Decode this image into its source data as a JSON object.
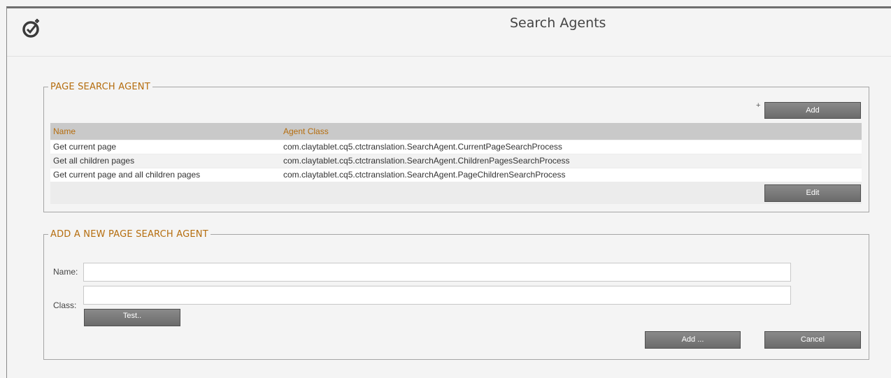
{
  "header": {
    "title": "Search Agents",
    "logo_icon": "target-check-icon"
  },
  "page_search_agent": {
    "legend": "PAGE SEARCH AGENT",
    "add_plus": "+",
    "add_label": "Add",
    "columns": [
      "Name",
      "Agent Class"
    ],
    "rows": [
      {
        "name": "Get current page",
        "agent_class": "com.claytablet.cq5.ctctranslation.SearchAgent.CurrentPageSearchProcess"
      },
      {
        "name": "Get all children pages",
        "agent_class": "com.claytablet.cq5.ctctranslation.SearchAgent.ChildrenPagesSearchProcess"
      },
      {
        "name": "Get current page and all children pages",
        "agent_class": "com.claytablet.cq5.ctctranslation.SearchAgent.PageChildrenSearchProcess"
      }
    ],
    "edit_label": "Edit"
  },
  "add_agent": {
    "legend": "ADD A NEW PAGE SEARCH AGENT",
    "name_label": "Name:",
    "name_value": "",
    "class_label": "Class:",
    "class_value": "",
    "test_label": "Test..",
    "add_label": "Add ...",
    "cancel_label": "Cancel"
  },
  "colors": {
    "accent": "#b56d0e",
    "button": "#777777",
    "grid_header": "#c9c9c9"
  }
}
